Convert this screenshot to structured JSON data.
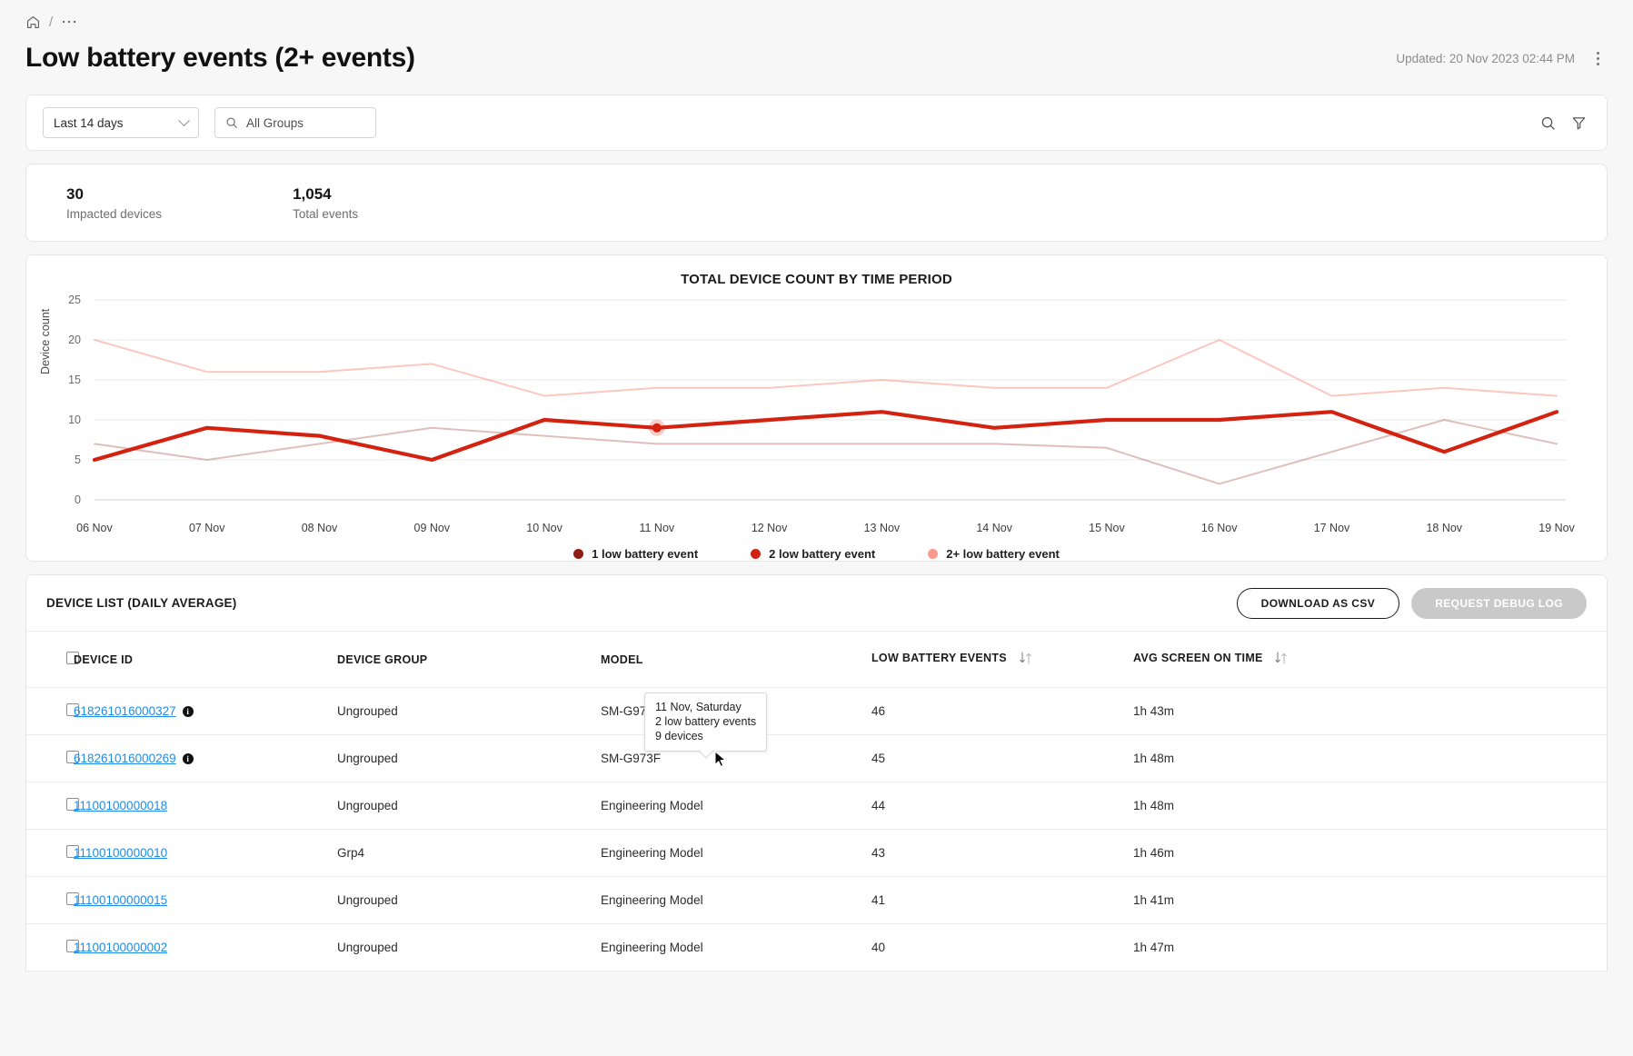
{
  "breadcrumb": {
    "home_icon": "home-icon",
    "separator": "/",
    "more": "⋯"
  },
  "header": {
    "title": "Low battery events (2+ events)",
    "updated": "Updated: 20 Nov 2023 02:44 PM",
    "menu_icon": "kebab-menu-icon"
  },
  "filters": {
    "date_range": "Last 14 days",
    "group_placeholder": "All Groups",
    "group_value": "",
    "search_icon": "search-icon",
    "filter_icon": "filter-icon",
    "chevron_icon": "chevron-down-icon"
  },
  "stats": [
    {
      "value": "30",
      "label": "Impacted devices"
    },
    {
      "value": "1,054",
      "label": "Total events"
    }
  ],
  "chart_data": {
    "type": "line",
    "title": "TOTAL DEVICE COUNT BY TIME PERIOD",
    "xlabel": "",
    "ylabel": "Device count",
    "ylim": [
      0,
      25
    ],
    "yticks": [
      0,
      5,
      10,
      15,
      20,
      25
    ],
    "grid": true,
    "legend_position": "bottom",
    "categories": [
      "06 Nov",
      "07 Nov",
      "08 Nov",
      "09 Nov",
      "10 Nov",
      "11 Nov",
      "12 Nov",
      "13 Nov",
      "14 Nov",
      "15 Nov",
      "16 Nov",
      "17 Nov",
      "18 Nov",
      "19 Nov"
    ],
    "series": [
      {
        "name": "1 low battery event",
        "color": "#8f1d14",
        "values": [
          7,
          5,
          7,
          9,
          8,
          7,
          7,
          7,
          7,
          6.5,
          2,
          6,
          10,
          7
        ]
      },
      {
        "name": "2 low battery event",
        "color": "#d42211",
        "values": [
          5,
          9,
          8,
          5,
          10,
          9,
          10,
          11,
          9,
          10,
          10,
          11,
          6,
          11
        ]
      },
      {
        "name": "2+ low battery event",
        "color": "#fb9a8c",
        "values": [
          20,
          16,
          16,
          17,
          13,
          14,
          14,
          15,
          14,
          14,
          20,
          13,
          14,
          13
        ]
      }
    ],
    "tooltip": {
      "date": "11 Nov, Saturday",
      "events": "2 low battery events",
      "devices": "9 devices"
    }
  },
  "table": {
    "section_title": "DEVICE LIST (DAILY AVERAGE)",
    "download_button": "DOWNLOAD AS CSV",
    "debug_button": "REQUEST DEBUG LOG",
    "columns": [
      {
        "key": "device_id",
        "label": "DEVICE ID",
        "sortable": false
      },
      {
        "key": "device_group",
        "label": "DEVICE GROUP",
        "sortable": false
      },
      {
        "key": "model",
        "label": "MODEL",
        "sortable": false
      },
      {
        "key": "low_battery_events",
        "label": "LOW BATTERY EVENTS",
        "sortable": true
      },
      {
        "key": "avg_screen_on_time",
        "label": "AVG SCREEN ON TIME",
        "sortable": true
      }
    ],
    "rows": [
      {
        "device_id": "618261016000327",
        "info": true,
        "device_group": "Ungrouped",
        "model": "SM-G973F",
        "low_battery_events": "46",
        "avg_screen_on_time": "1h 43m"
      },
      {
        "device_id": "618261016000269",
        "info": true,
        "device_group": "Ungrouped",
        "model": "SM-G973F",
        "low_battery_events": "45",
        "avg_screen_on_time": "1h 48m"
      },
      {
        "device_id": "11100100000018",
        "info": false,
        "device_group": "Ungrouped",
        "model": "Engineering Model",
        "low_battery_events": "44",
        "avg_screen_on_time": "1h 48m"
      },
      {
        "device_id": "11100100000010",
        "info": false,
        "device_group": "Grp4",
        "model": "Engineering Model",
        "low_battery_events": "43",
        "avg_screen_on_time": "1h 46m"
      },
      {
        "device_id": "11100100000015",
        "info": false,
        "device_group": "Ungrouped",
        "model": "Engineering Model",
        "low_battery_events": "41",
        "avg_screen_on_time": "1h 41m"
      },
      {
        "device_id": "11100100000002",
        "info": false,
        "device_group": "Ungrouped",
        "model": "Engineering Model",
        "low_battery_events": "40",
        "avg_screen_on_time": "1h 47m"
      }
    ]
  },
  "colors": {
    "accent": "#d42211",
    "link": "#1f8ceb",
    "series_dark": "#8f1d14",
    "series_mid": "#d42211",
    "series_light": "#fb9a8c"
  }
}
